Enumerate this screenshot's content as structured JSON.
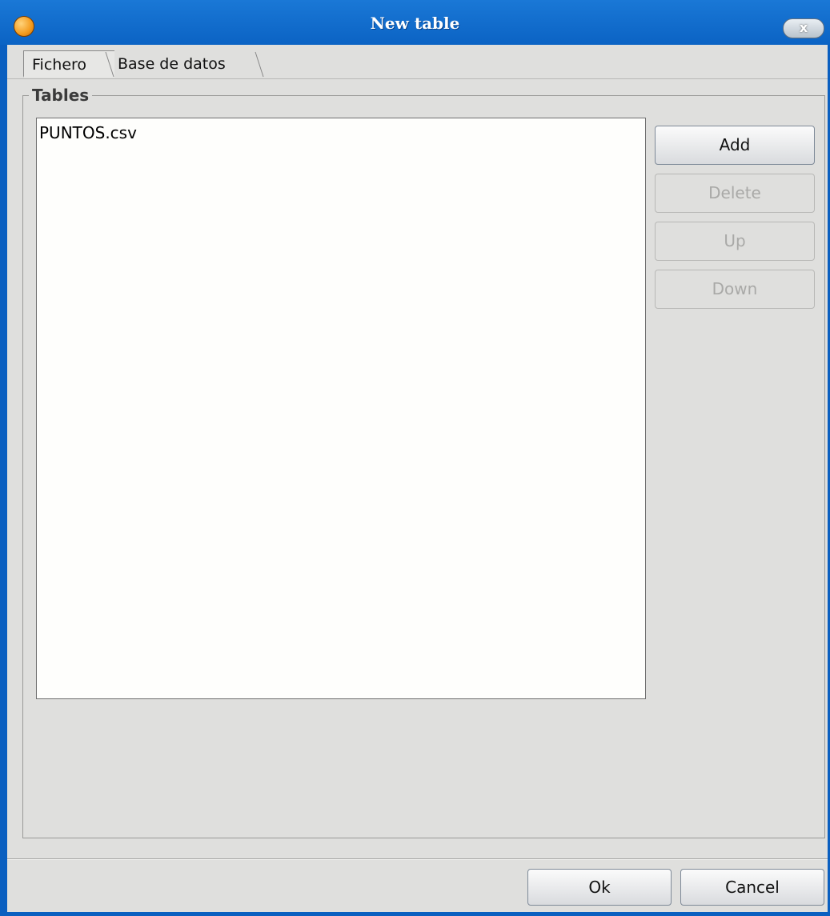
{
  "window": {
    "title": "New table",
    "close_label": "x"
  },
  "tabs": [
    {
      "label": "Fichero",
      "selected": true
    },
    {
      "label": "Base de datos",
      "selected": false
    }
  ],
  "tables_group": {
    "label": "Tables",
    "items": [
      "PUNTOS.csv"
    ]
  },
  "side_buttons": {
    "add": "Add",
    "delete": "Delete",
    "up": "Up",
    "down": "Down"
  },
  "footer": {
    "ok": "Ok",
    "cancel": "Cancel"
  },
  "colors": {
    "titlebar": "#0b63c4",
    "background": "#dfdfdd",
    "disabled_text": "#a9a9a7"
  }
}
